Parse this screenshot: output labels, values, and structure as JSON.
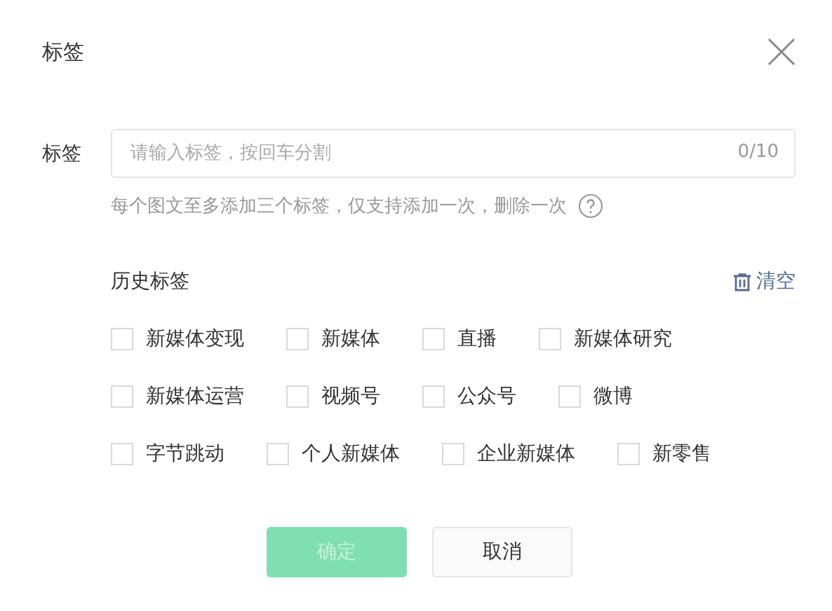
{
  "dialog": {
    "title": "标签"
  },
  "tag_field": {
    "label": "标签",
    "placeholder": "请输入标签，按回车分割",
    "counter": "0/10",
    "hint": "每个图文至多添加三个标签，仅支持添加一次，删除一次"
  },
  "history": {
    "title": "历史标签",
    "clear": "清空",
    "rows": [
      [
        {
          "label": "新媒体变现",
          "checked": false
        },
        {
          "label": "新媒体",
          "checked": false
        },
        {
          "label": "直播",
          "checked": false
        },
        {
          "label": "新媒体研究",
          "checked": false
        }
      ],
      [
        {
          "label": "新媒体运营",
          "checked": false
        },
        {
          "label": "视频号",
          "checked": false
        },
        {
          "label": "公众号",
          "checked": false
        },
        {
          "label": "微博",
          "checked": false
        }
      ],
      [
        {
          "label": "字节跳动",
          "checked": false
        },
        {
          "label": "个人新媒体",
          "checked": false
        },
        {
          "label": "企业新媒体",
          "checked": false
        },
        {
          "label": "新零售",
          "checked": false
        }
      ]
    ]
  },
  "buttons": [
    {
      "label": "确定",
      "kind": "primary",
      "disabled": true
    },
    {
      "label": "取消",
      "kind": "default",
      "disabled": false
    }
  ]
}
